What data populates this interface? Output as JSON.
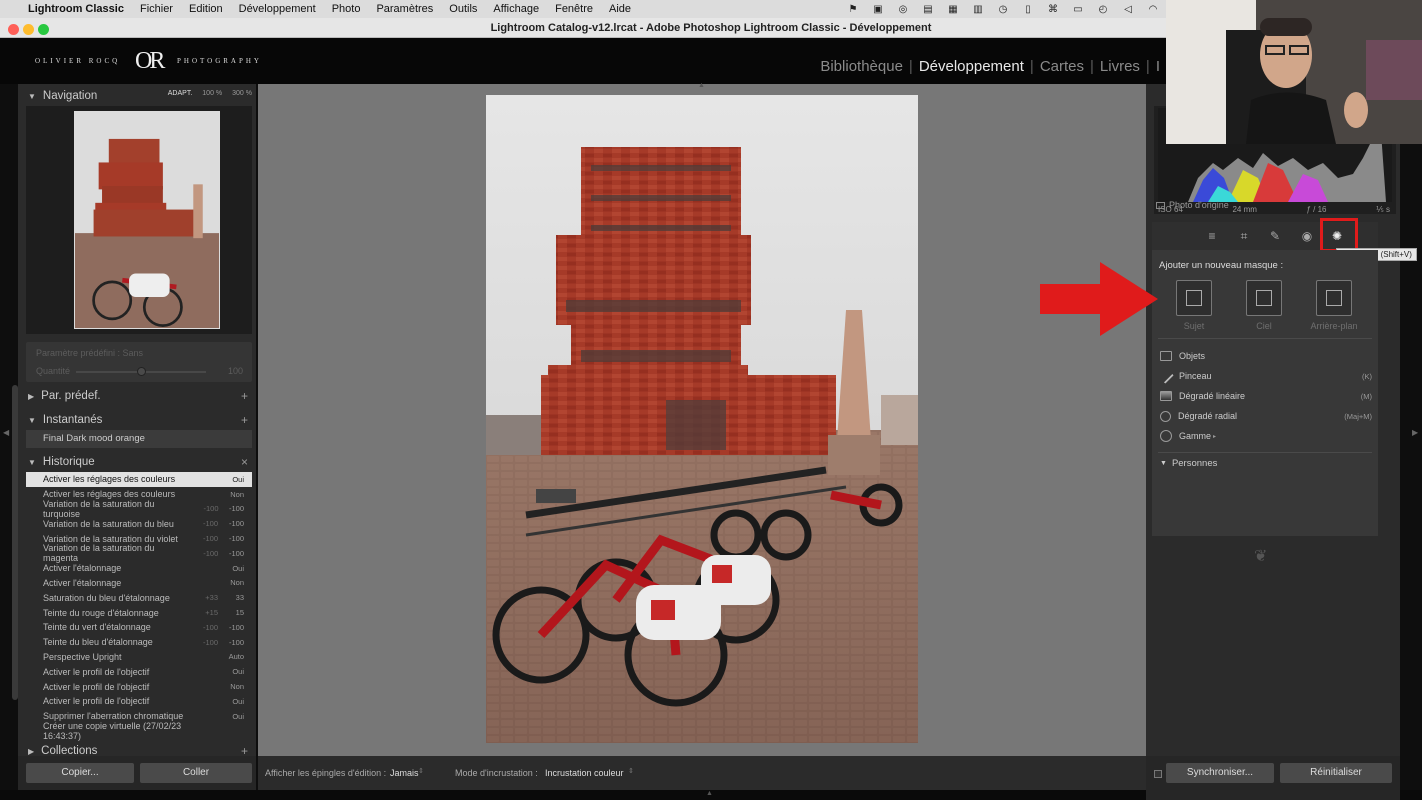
{
  "menubar": {
    "app_name": "Lightroom Classic",
    "items": [
      "Fichier",
      "Edition",
      "Développement",
      "Photo",
      "Paramètres",
      "Outils",
      "Affichage",
      "Fenêtre",
      "Aide"
    ]
  },
  "window": {
    "title": "Lightroom Catalog-v12.lrcat - Adobe Photoshop Lightroom Classic - Développement"
  },
  "identity_plate": {
    "left_text": "OLIVIER ROCQ",
    "mark": "OR",
    "right_text": "PHOTOGRAPHY"
  },
  "modules": [
    "Bibliothèque",
    "Développement",
    "Cartes",
    "Livres",
    "I"
  ],
  "active_module": "Développement",
  "navigator": {
    "title": "Navigation",
    "zoom_options": [
      "ADAPT.",
      "100 %",
      "300 %"
    ],
    "selected_zoom": "ADAPT."
  },
  "preset_strength": {
    "preset_label": "Paramètre prédéfini : Sans",
    "quality_label": "Quantité",
    "quality_value": "100",
    "quality_fraction": 0.5
  },
  "presets_panel": {
    "title": "Par. prédef."
  },
  "snapshots": {
    "title": "Instantanés",
    "items": [
      "Final Dark mood orange"
    ]
  },
  "history": {
    "title": "Historique",
    "close_glyph": "×",
    "rows": [
      {
        "label": "Activer les réglages des couleurs",
        "before": "",
        "after": "Oui"
      },
      {
        "label": "Activer les réglages des couleurs",
        "before": "",
        "after": "Non"
      },
      {
        "label": "Variation de la saturation du turquoise",
        "before": "-100",
        "after": "-100"
      },
      {
        "label": "Variation de la saturation du bleu",
        "before": "-100",
        "after": "-100"
      },
      {
        "label": "Variation de la saturation du violet",
        "before": "-100",
        "after": "-100"
      },
      {
        "label": "Variation de la saturation du magenta",
        "before": "-100",
        "after": "-100"
      },
      {
        "label": "Activer l'étalonnage",
        "before": "",
        "after": "Oui"
      },
      {
        "label": "Activer l'étalonnage",
        "before": "",
        "after": "Non"
      },
      {
        "label": "Saturation du bleu d'étalonnage",
        "before": "+33",
        "after": "33"
      },
      {
        "label": "Teinte du rouge d'étalonnage",
        "before": "+15",
        "after": "15"
      },
      {
        "label": "Teinte du vert d'étalonnage",
        "before": "-100",
        "after": "-100"
      },
      {
        "label": "Teinte du bleu d'étalonnage",
        "before": "-100",
        "after": "-100"
      },
      {
        "label": "Perspective Upright",
        "before": "",
        "after": "Auto"
      },
      {
        "label": "Activer le profil de l'objectif",
        "before": "",
        "after": "Oui"
      },
      {
        "label": "Activer le profil de l'objectif",
        "before": "",
        "after": "Non"
      },
      {
        "label": "Activer le profil de l'objectif",
        "before": "",
        "after": "Oui"
      },
      {
        "label": "Supprimer l'aberration chromatique",
        "before": "",
        "after": "Oui"
      },
      {
        "label": "Créer une copie virtuelle (27/02/23 16:43:37)",
        "before": "",
        "after": ""
      }
    ]
  },
  "collections": {
    "title": "Collections"
  },
  "left_buttons": {
    "copy": "Copier...",
    "paste": "Coller"
  },
  "toolbar": {
    "pins_label": "Afficher les épingles d'édition :",
    "pins_value": "Jamais",
    "overlay_label": "Mode d'incrustation :",
    "overlay_value": "Incrustation couleur"
  },
  "histogram_info": {
    "iso": "ISO 64",
    "focal": "24 mm",
    "aperture": "ƒ / 16",
    "shutter": "⅕ s",
    "original_photo": "Photo d'origine"
  },
  "tools": [
    "sliders-icon",
    "crop-icon",
    "heal-icon",
    "red-eye-icon",
    "mask-icon"
  ],
  "tooltip": "Masquage (Shift+V)",
  "mask_panel": {
    "title": "Ajouter un nouveau masque :",
    "quick": [
      "Sujet",
      "Ciel",
      "Arrière-plan"
    ],
    "items": [
      {
        "label": "Objets",
        "key": ""
      },
      {
        "label": "Pinceau",
        "key": "(K)"
      },
      {
        "label": "Dégradé linéaire",
        "key": "(M)"
      },
      {
        "label": "Dégradé radial",
        "key": "(Maj+M)"
      },
      {
        "label": "Gamme",
        "key": ""
      }
    ],
    "people_title": "Personnes"
  },
  "right_buttons": {
    "sync": "Synchroniser...",
    "reset": "Réinitialiser"
  },
  "colors": {
    "accent_red": "#e01b1b",
    "brick": "#a63a28",
    "panel": "#2b2b2b"
  }
}
